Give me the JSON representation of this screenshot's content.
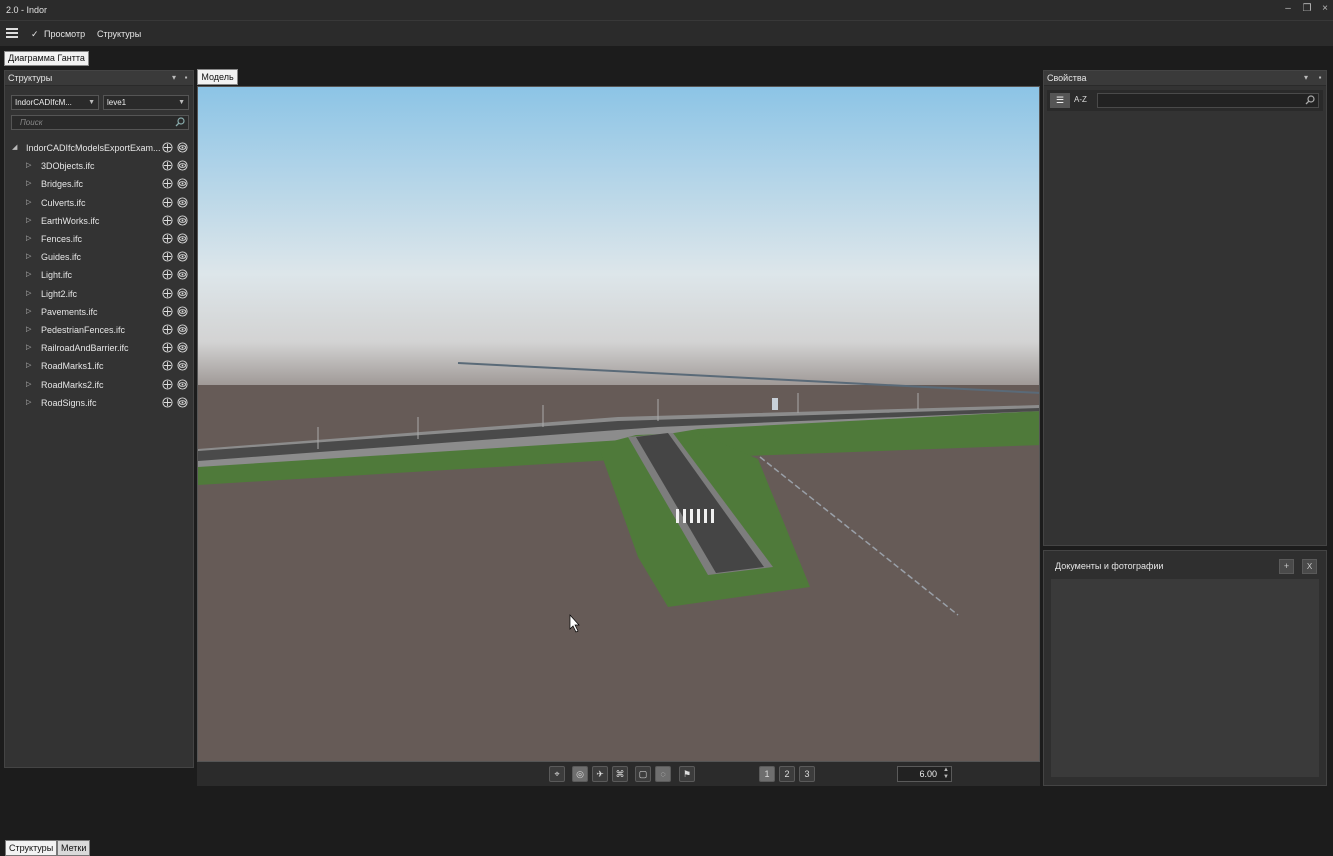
{
  "window": {
    "title": "2.0 - Indor"
  },
  "menu": {
    "view_label": "Просмотр",
    "structures_label": "Структуры",
    "view_checked": "✓"
  },
  "toolbar": {
    "gantt_label": "Диаграмма Гантта"
  },
  "left_panel": {
    "title": "Структуры",
    "project_select": "IndorCADIfcM...",
    "level_select": "leve1",
    "search_placeholder": "Поиск",
    "root_item": "IndorCADIfcModelsExportExam...",
    "items": [
      "3DObjects.ifc",
      "Bridges.ifc",
      "Culverts.ifc",
      "EarthWorks.ifc",
      "Fences.ifc",
      "Guides.ifc",
      "Light.ifc",
      "Light2.ifc",
      "Pavements.ifc",
      "PedestrianFences.ifc",
      "RailroadAndBarrier.ifc",
      "RoadMarks1.ifc",
      "RoadMarks2.ifc",
      "RoadSigns.ifc"
    ],
    "tabs": [
      "Структуры",
      "Метки"
    ]
  },
  "center": {
    "tab_label": "Модель",
    "zoom_value": "6.00",
    "view_buttons": [
      "1",
      "2",
      "3"
    ]
  },
  "right_panel": {
    "title": "Свойства",
    "sort_az_label": "A-Z",
    "docs_title": "Документы и фотографии",
    "docs_add": "+",
    "docs_close": "X"
  },
  "colors": {
    "sky_top": "#8cc4e6",
    "sky_horizon": "#d9dcdd",
    "ground": "#665b57",
    "embankment": "#4f7a3a",
    "road": "#4a4a4a"
  }
}
